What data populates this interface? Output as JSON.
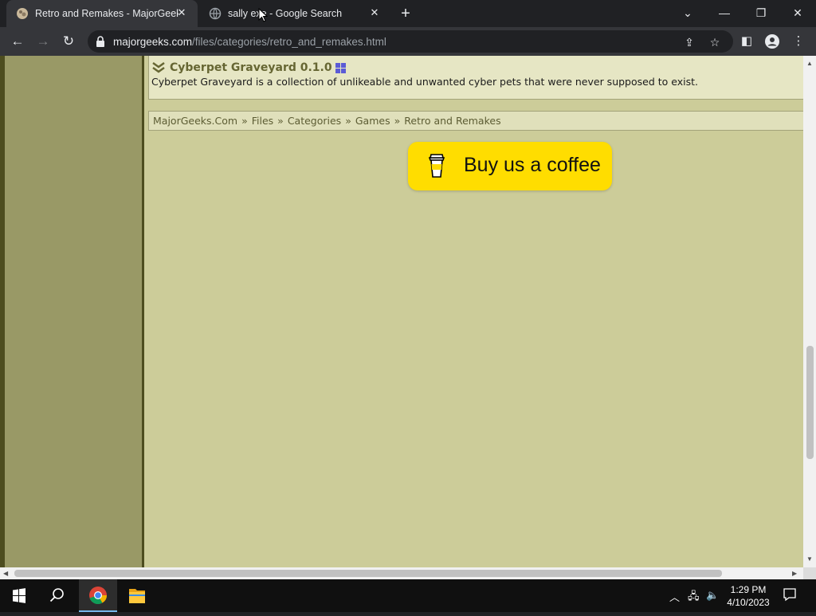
{
  "browser": {
    "tabs": [
      {
        "title": "Retro and Remakes - MajorGeeks",
        "active": true
      },
      {
        "title": "sally exe - Google Search",
        "active": false
      }
    ],
    "new_tab": "+",
    "url_host": "majorgeeks.com",
    "url_path": "/files/categories/retro_and_remakes.html"
  },
  "page": {
    "entry": {
      "title": "Cyberpet Graveyard 0.1.0",
      "description": "Cyberpet Graveyard is a collection of unlikeable and unwanted cyber pets that were never supposed to exist."
    },
    "breadcrumb": [
      "MajorGeeks.Com",
      "Files",
      "Categories",
      "Games",
      "Retro and Remakes"
    ],
    "breadcrumb_sep": "»",
    "coffee_button": "Buy us a coffee"
  },
  "taskbar": {
    "time": "1:29 PM",
    "date": "4/10/2023"
  },
  "colors": {
    "page_bg": "#cccc99",
    "sidebar": "#999966",
    "coffee_yellow": "#ffdd00",
    "entry_title": "#666633"
  }
}
